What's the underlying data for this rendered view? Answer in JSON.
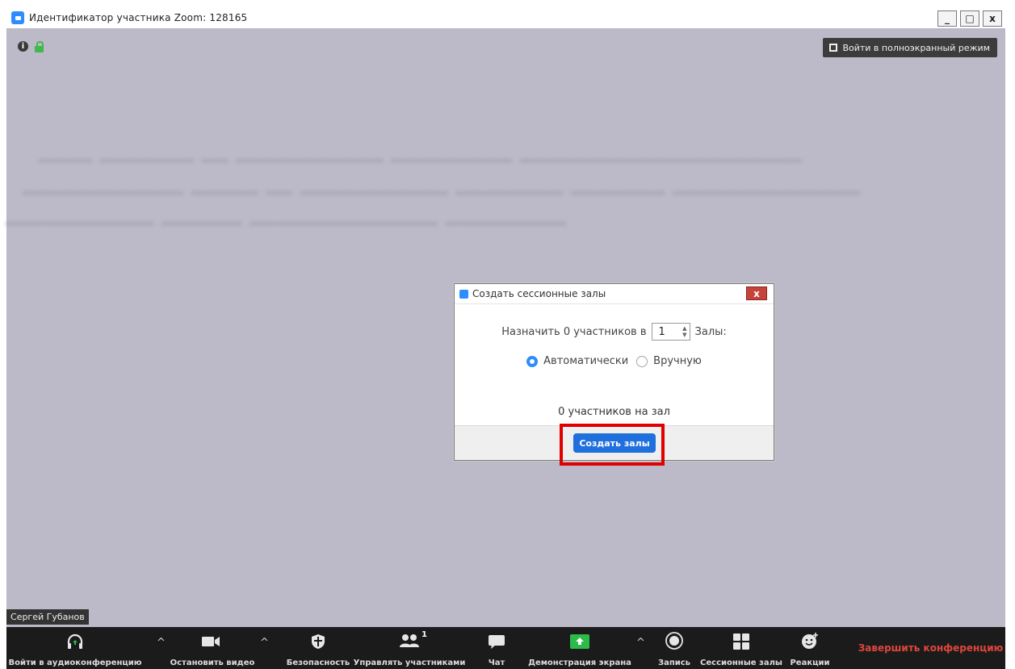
{
  "window": {
    "title": "Идентификатор участника Zoom: 128165",
    "min": "_",
    "max": "□",
    "close": "x"
  },
  "stage": {
    "fullscreen_label": "Войти в полноэкранный режим",
    "participant_name": "Сергей Губанов"
  },
  "dialog": {
    "title": "Создать сессионные залы",
    "close_label": "x",
    "assign_prefix": "Назначить 0 участников в",
    "rooms_value": "1",
    "assign_suffix": "Залы:",
    "radio_auto": "Автоматически",
    "radio_manual": "Вручную",
    "selected_mode": "Автоматически",
    "per_room_text": "0 участников на зал",
    "create_button": "Создать залы"
  },
  "toolbar": {
    "audio": "Войти в аудиоконференцию",
    "video": "Остановить видео",
    "security": "Безопасность",
    "participants": "Управлять участниками",
    "participants_count": "1",
    "chat": "Чат",
    "share": "Демонстрация экрана",
    "record": "Запись",
    "breakout": "Сессионные залы",
    "reactions": "Реакции",
    "end": "Завершить конференцию"
  },
  "colors": {
    "accent": "#2d8cff",
    "highlight": "#e00000",
    "end": "#e0463c",
    "share_green": "#2dba4a"
  }
}
